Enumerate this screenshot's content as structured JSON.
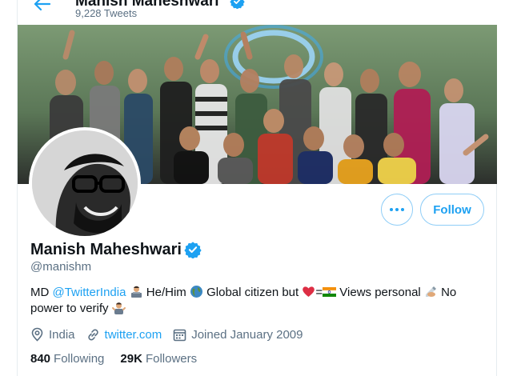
{
  "header": {
    "name": "Manish Maheshwari",
    "tweets_count": "9,228 Tweets"
  },
  "profile": {
    "display_name": "Manish Maheshwari",
    "handle": "@manishm",
    "bio": {
      "part1": "MD ",
      "mention": "@TwitterIndia",
      "part2": " He/Him ",
      "part3": " Global citizen but ",
      "equals": "=",
      "part4": " Views personal ",
      "part5": " No power to verify "
    },
    "location": "India",
    "website": "twitter.com",
    "joined": "Joined January 2009",
    "following_count": "840",
    "following_label": "Following",
    "followers_count": "29K",
    "followers_label": "Followers"
  },
  "actions": {
    "follow_label": "Follow"
  },
  "colors": {
    "accent": "#1da1f2",
    "secondary_text": "#5b7083",
    "primary_text": "#0f1419"
  }
}
